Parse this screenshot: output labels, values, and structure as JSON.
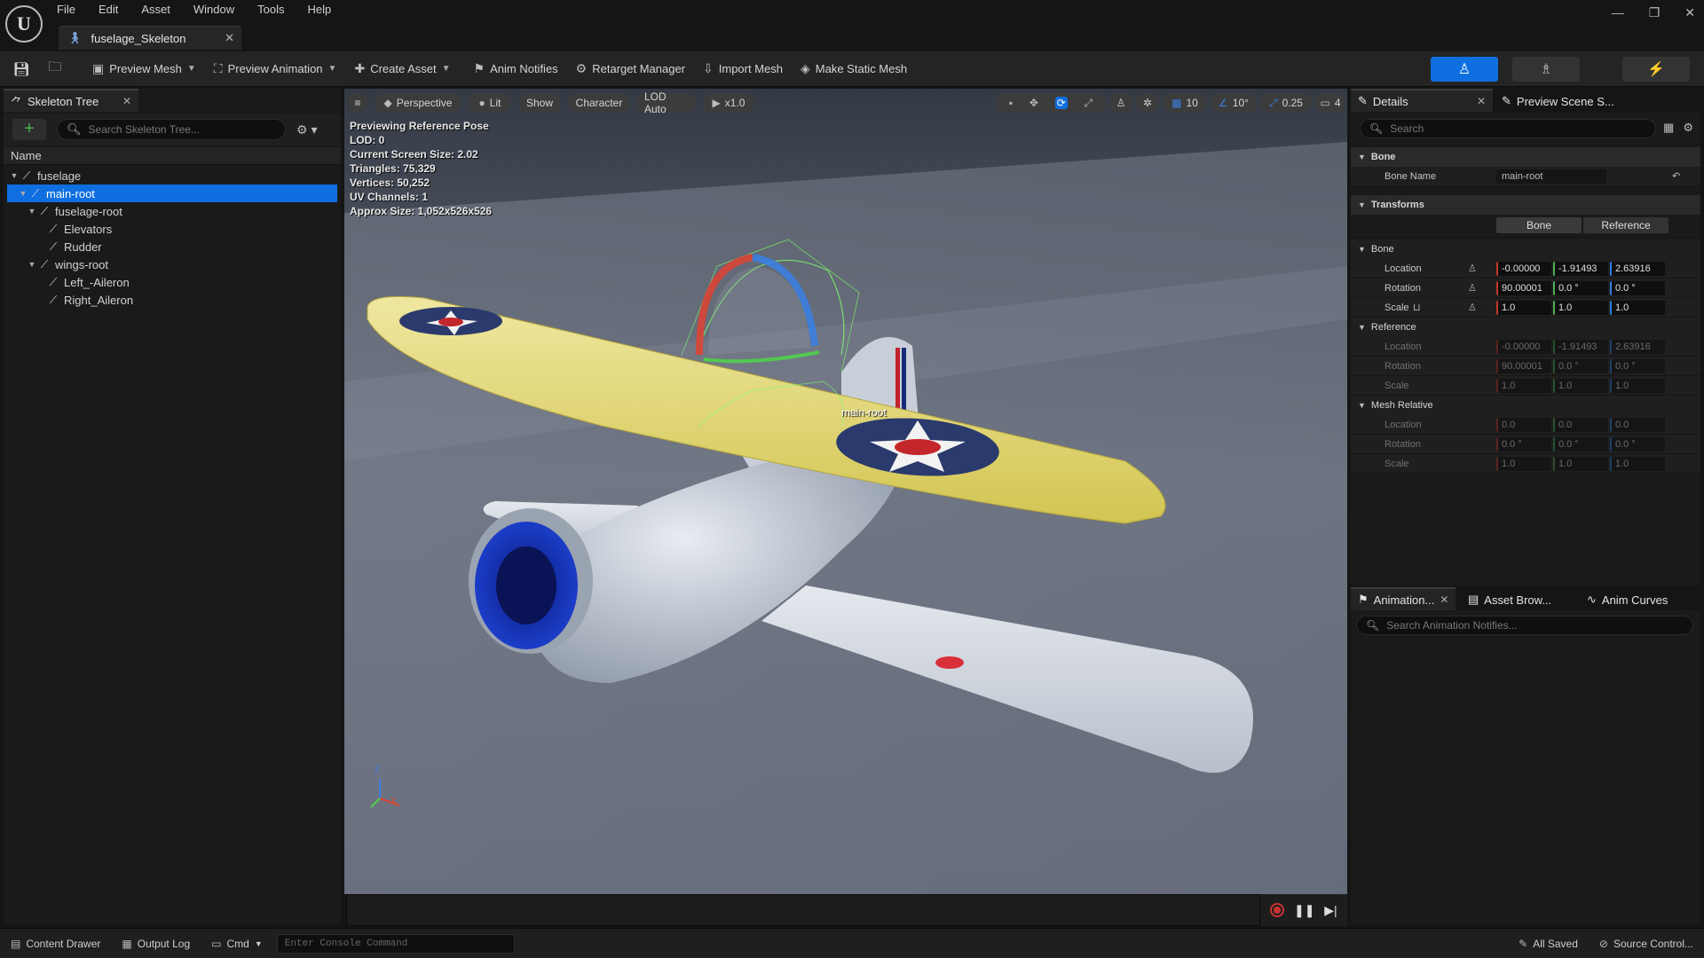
{
  "app": {
    "menu": [
      "File",
      "Edit",
      "Asset",
      "Window",
      "Tools",
      "Help"
    ],
    "doc_tab": "fuselage_Skeleton",
    "window_controls": [
      "minimize",
      "restore",
      "close"
    ]
  },
  "toolbar": {
    "preview_mesh": "Preview Mesh",
    "preview_animation": "Preview Animation",
    "create_asset": "Create Asset",
    "anim_notifies": "Anim Notifies",
    "retarget_manager": "Retarget Manager",
    "import_mesh": "Import Mesh",
    "make_static_mesh": "Make Static Mesh",
    "accent_color": "#0f6fe0"
  },
  "skeleton_tree": {
    "tab_label": "Skeleton Tree",
    "search_placeholder": "Search Skeleton Tree...",
    "column_header": "Name",
    "bones": [
      {
        "name": "fuselage",
        "depth": 0,
        "expanded": true,
        "selected": false
      },
      {
        "name": "main-root",
        "depth": 1,
        "expanded": true,
        "selected": true
      },
      {
        "name": "fuselage-root",
        "depth": 2,
        "expanded": true,
        "selected": false
      },
      {
        "name": "Elevators",
        "depth": 3,
        "expanded": false,
        "selected": false
      },
      {
        "name": "Rudder",
        "depth": 3,
        "expanded": false,
        "selected": false
      },
      {
        "name": "wings-root",
        "depth": 2,
        "expanded": true,
        "selected": false
      },
      {
        "name": "Left_-Aileron",
        "depth": 3,
        "expanded": false,
        "selected": false
      },
      {
        "name": "Right_Aileron",
        "depth": 3,
        "expanded": false,
        "selected": false
      }
    ]
  },
  "viewport": {
    "perspective": "Perspective",
    "lit": "Lit",
    "show": "Show",
    "character": "Character",
    "lod": "LOD Auto",
    "play_rate": "x1.0",
    "grid_snap": "10",
    "rot_snap": "10°",
    "scale_snap": "0.25",
    "camera_speed": "4",
    "info": [
      "Previewing Reference Pose",
      "LOD: 0",
      "Current Screen Size: 2.02",
      "Triangles: 75,329",
      "Vertices: 50,252",
      "UV Channels: 1",
      "Approx Size: 1,052x526x526"
    ],
    "selected_bone_label": "main-root",
    "axis_labels": {
      "z": "Z",
      "x": "X"
    }
  },
  "details": {
    "tab_label": "Details",
    "tab2_label": "Preview Scene S...",
    "search_placeholder": "Search",
    "section_bone": "Bone",
    "bone_name_label": "Bone Name",
    "bone_name_value": "main-root",
    "section_transforms": "Transforms",
    "toggle_bone": "Bone",
    "toggle_reference": "Reference",
    "sub_bone": "Bone",
    "sub_reference": "Reference",
    "sub_mesh_relative": "Mesh Relative",
    "labels": {
      "location": "Location",
      "rotation": "Rotation",
      "scale": "Scale"
    },
    "bone_transform": {
      "location": [
        "-0.00000",
        "-1.91493",
        "2.63916"
      ],
      "rotation": [
        "90.00001",
        "0.0 °",
        "0.0 °"
      ],
      "scale": [
        "1.0",
        "1.0",
        "1.0"
      ]
    },
    "reference_transform": {
      "location": [
        "-0.00000",
        "-1.91493",
        "2.63916"
      ],
      "rotation": [
        "90.00001",
        "0.0 °",
        "0.0 °"
      ],
      "scale": [
        "1.0",
        "1.0",
        "1.0"
      ]
    },
    "mesh_relative_transform": {
      "location": [
        "0.0",
        "0.0",
        "0.0"
      ],
      "rotation": [
        "0.0 °",
        "0.0 °",
        "0.0 °"
      ],
      "scale": [
        "1.0",
        "1.0",
        "1.0"
      ]
    }
  },
  "lower_panel": {
    "tab_animation": "Animation...",
    "tab_asset_browser": "Asset Brow...",
    "tab_anim_curves": "Anim Curves",
    "search_placeholder": "Search Animation Notifies..."
  },
  "statusbar": {
    "content_drawer": "Content Drawer",
    "output_log": "Output Log",
    "cmd": "Cmd",
    "console_placeholder": "Enter Console Command",
    "all_saved": "All Saved",
    "source_control": "Source Control..."
  }
}
